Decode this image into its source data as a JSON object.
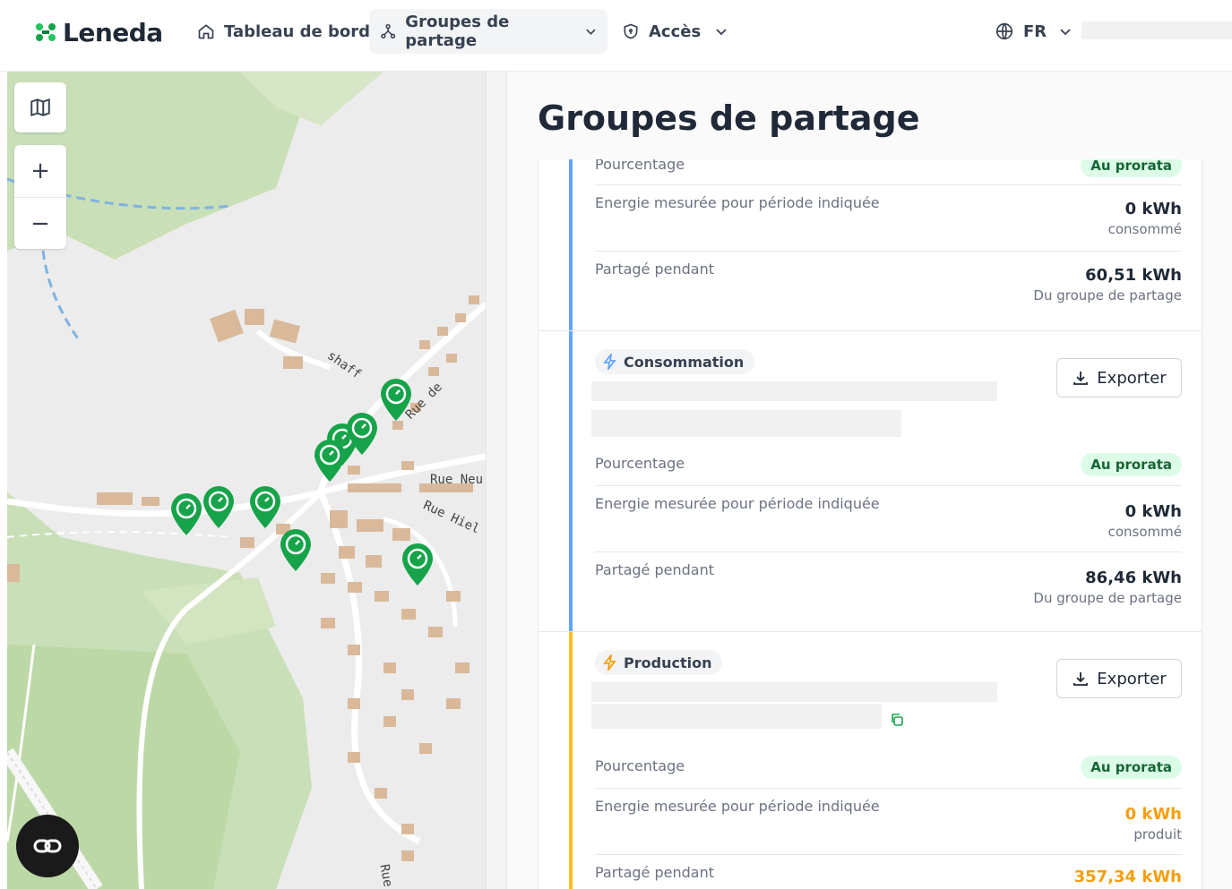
{
  "app": {
    "brand": "Leneda"
  },
  "nav": {
    "items": [
      {
        "label": "Tableau de bord",
        "icon": "home-icon"
      },
      {
        "label": "Groupes de partage",
        "icon": "network-icon",
        "active": true
      },
      {
        "label": "Accès",
        "icon": "shield-icon"
      }
    ],
    "language": "FR"
  },
  "map": {
    "labels": {
      "street1": "Rue Neu",
      "street2": "Rue Hiel",
      "street3": "Rue de",
      "street4": "shaff",
      "street5": "Rue"
    }
  },
  "page": {
    "title": "Groupes de partage"
  },
  "sections": [
    {
      "color": "#60a5fa",
      "rows": [
        {
          "label": "Pourcentage",
          "badge": "Au prorata"
        },
        {
          "label": "Energie mesurée pour période indiquée",
          "value": "0 kWh",
          "sub": "consommé"
        },
        {
          "label": "Partagé pendant",
          "value": "60,51 kWh",
          "sub": "Du groupe de partage"
        }
      ]
    },
    {
      "type_label": "Consommation",
      "export_label": "Exporter",
      "color": "#60a5fa",
      "rows": [
        {
          "label": "Pourcentage",
          "badge": "Au prorata"
        },
        {
          "label": "Energie mesurée pour période indiquée",
          "value": "0 kWh",
          "sub": "consommé"
        },
        {
          "label": "Partagé pendant",
          "value": "86,46 kWh",
          "sub": "Du groupe de partage"
        }
      ]
    },
    {
      "type_label": "Production",
      "export_label": "Exporter",
      "color": "#fbbf24",
      "rows": [
        {
          "label": "Pourcentage",
          "badge": "Au prorata"
        },
        {
          "label": "Energie mesurée pour période indiquée",
          "value": "0 kWh",
          "sub": "produit"
        },
        {
          "label": "Partagé pendant",
          "value": "357,34 kWh"
        }
      ]
    }
  ]
}
